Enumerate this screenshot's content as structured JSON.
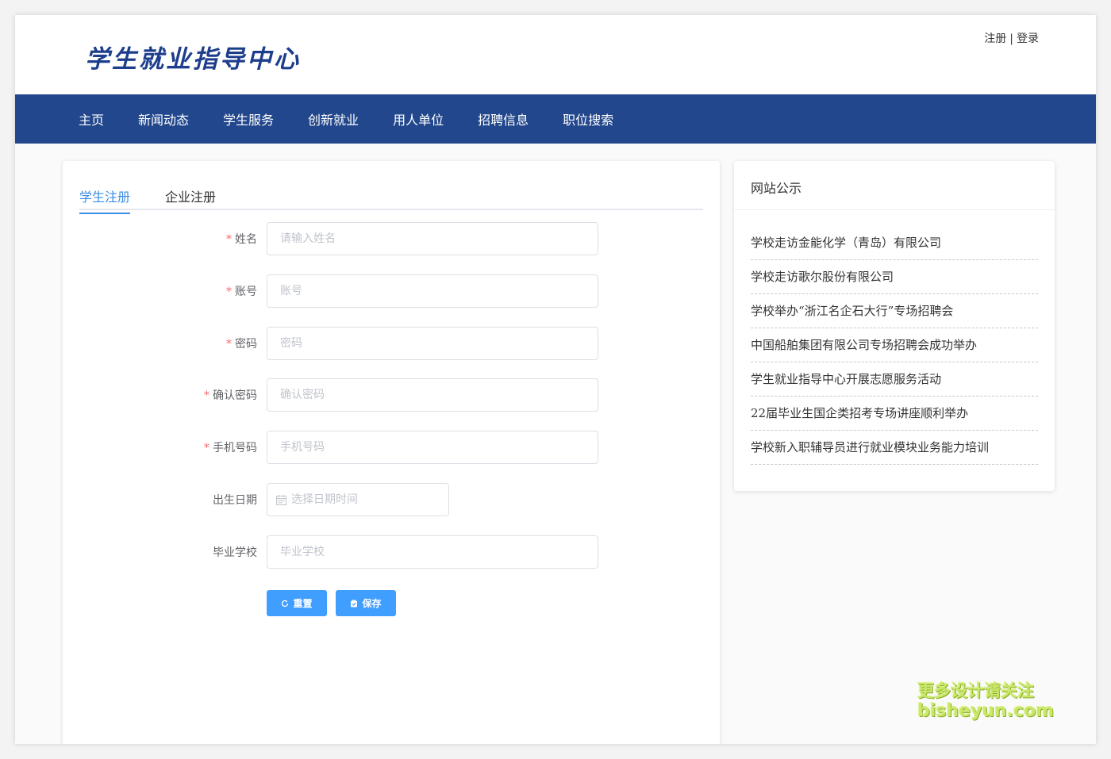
{
  "header": {
    "logo_text": "学生就业指导中心",
    "register_link": "注册",
    "separator": "|",
    "login_link": "登录"
  },
  "nav": {
    "items": [
      {
        "label": "主页"
      },
      {
        "label": "新闻动态"
      },
      {
        "label": "学生服务"
      },
      {
        "label": "创新就业"
      },
      {
        "label": "用人单位"
      },
      {
        "label": "招聘信息"
      },
      {
        "label": "职位搜索"
      }
    ]
  },
  "form": {
    "tabs": [
      {
        "label": "学生注册",
        "active": true
      },
      {
        "label": "企业注册",
        "active": false
      }
    ],
    "required_mark": "*",
    "fields": [
      {
        "label": "姓名",
        "placeholder": "请输入姓名",
        "required": true
      },
      {
        "label": "账号",
        "placeholder": "账号",
        "required": true
      },
      {
        "label": "密码",
        "placeholder": "密码",
        "required": true
      },
      {
        "label": "确认密码",
        "placeholder": "确认密码",
        "required": true
      },
      {
        "label": "手机号码",
        "placeholder": "手机号码",
        "required": true
      },
      {
        "label": "出生日期",
        "placeholder": "选择日期时间",
        "required": false,
        "icon": "calendar-icon"
      },
      {
        "label": "毕业学校",
        "placeholder": "毕业学校",
        "required": false
      }
    ],
    "reset_label": "重置",
    "save_label": "保存"
  },
  "sidebar": {
    "title": "网站公示",
    "news": [
      {
        "title": "学校走访金能化学（青岛）有限公司"
      },
      {
        "title": "学校走访歌尔股份有限公司"
      },
      {
        "title": "学校举办“浙江名企石大行”专场招聘会"
      },
      {
        "title": "中国船舶集团有限公司专场招聘会成功举办"
      },
      {
        "title": "学生就业指导中心开展志愿服务活动"
      },
      {
        "title": "22届毕业生国企类招考专场讲座顺利举办"
      },
      {
        "title": "学校新入职辅导员进行就业模块业务能力培训"
      }
    ]
  },
  "watermark": {
    "line1": "更多设计请关注",
    "line2": "bisheyun.com"
  },
  "colors": {
    "nav_bg": "#22478c",
    "logo": "#1d3e8c",
    "accent": "#409eff",
    "required": "#f56c6c"
  }
}
